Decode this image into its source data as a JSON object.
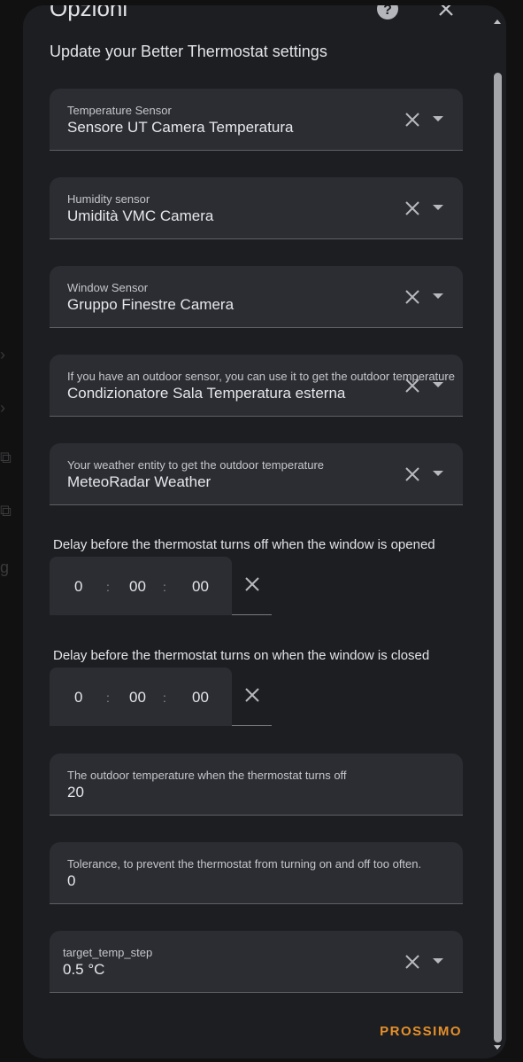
{
  "background": {
    "hint_text": "g"
  },
  "dialog": {
    "title": "Opzioni",
    "subtitle": "Update your Better Thermostat settings",
    "help_icon": "help-circle-icon",
    "close_icon": "close-icon",
    "next_label": "PROSSIMO"
  },
  "fields": [
    {
      "label": "Temperature Sensor",
      "value": "Sensore UT Camera Temperatura"
    },
    {
      "label": "Humidity sensor",
      "value": "Umidità VMC Camera"
    },
    {
      "label": "Window Sensor",
      "value": "Gruppo Finestre Camera"
    },
    {
      "label": "If you have an outdoor sensor, you can use it to get the outdoor temperature",
      "value": "Condizionatore Sala Temperatura esterna"
    },
    {
      "label": "Your weather entity to get the outdoor temperature",
      "value": "MeteoRadar Weather"
    }
  ],
  "durations": [
    {
      "label": "Delay before the thermostat turns off when the window is opened",
      "hours": "0",
      "minutes": "00",
      "seconds": "00",
      "sep": ":"
    },
    {
      "label": "Delay before the thermostat turns on when the window is closed",
      "hours": "0",
      "minutes": "00",
      "seconds": "00",
      "sep": ":"
    }
  ],
  "numbers": [
    {
      "label": "The outdoor temperature when the thermostat turns off",
      "value": "20"
    },
    {
      "label": "Tolerance, to prevent the thermostat from turning on and off too often.",
      "value": "0"
    }
  ],
  "target_step": {
    "label": "target_temp_step",
    "value": "0.5 °C"
  },
  "colors": {
    "accent": "#e6902a",
    "surface": "#1d1e22",
    "field": "#2c2d33"
  }
}
